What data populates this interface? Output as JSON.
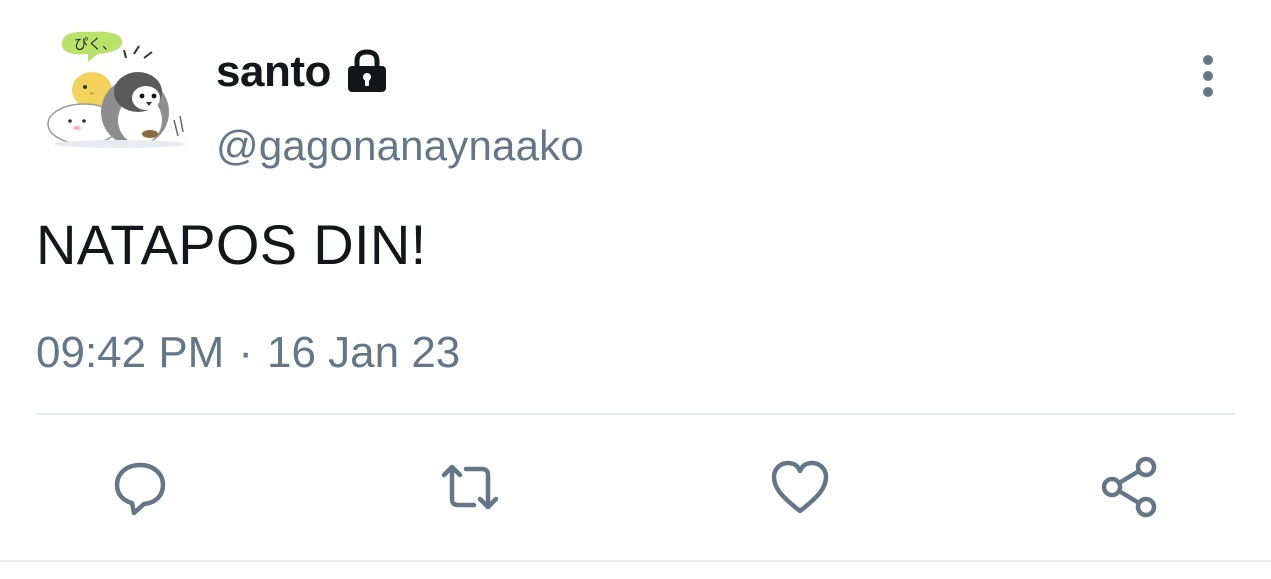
{
  "tweet": {
    "display_name": "santo",
    "handle": "@gagonanaynaako",
    "text": "NATAPOS DIN!",
    "time": "09:42 PM",
    "separator": "·",
    "date": "16 Jan 23",
    "protected": true,
    "avatar_caption": "ぴく、"
  },
  "icons": {
    "lock": "lock-icon",
    "more": "more-vertical-icon",
    "reply": "reply-icon",
    "retweet": "retweet-icon",
    "like": "heart-icon",
    "share": "share-icon"
  },
  "colors": {
    "text_primary": "#14171a",
    "text_secondary": "#657786",
    "icon": "#657786",
    "divider": "#e6ecf0"
  }
}
